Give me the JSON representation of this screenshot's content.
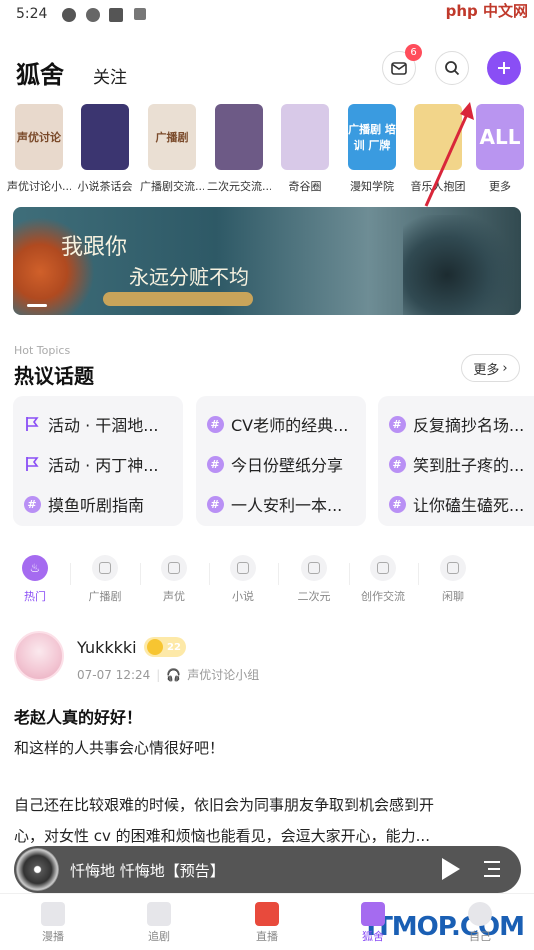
{
  "status": {
    "time": "5:24",
    "watermark": "php 中文网"
  },
  "header": {
    "title": "狐舍",
    "follow": "关注",
    "mail_badge": "6"
  },
  "circles": [
    {
      "label": "声优讨论小...",
      "thumb_text": "声优讨论",
      "color": "#e8d9cc"
    },
    {
      "label": "小说茶话会",
      "thumb_text": "",
      "color": "#3b3570"
    },
    {
      "label": "广播剧交流...",
      "thumb_text": "广播剧",
      "color": "#eadfd3"
    },
    {
      "label": "二次元交流...",
      "thumb_text": "",
      "color": "#6d5a86"
    },
    {
      "label": "奇谷圈",
      "thumb_text": "",
      "color": "#d8c9e8"
    },
    {
      "label": "漫知学院",
      "thumb_text": "广播剧 培训 厂牌",
      "color": "#3a9be0"
    },
    {
      "label": "音乐人抱团",
      "thumb_text": "",
      "color": "#f2d58a"
    },
    {
      "label": "更多",
      "thumb_text": "ALL",
      "color": "#b995f0"
    }
  ],
  "banner": {
    "line1": "我跟你",
    "line2": "永远分赃不均"
  },
  "hot": {
    "en": "Hot Topics",
    "title": "热议话题",
    "more": "更多"
  },
  "topics": [
    [
      {
        "icon": "flag",
        "text": "活动 · 干涸地..."
      },
      {
        "icon": "flag",
        "text": "活动 · 丙丁神..."
      },
      {
        "icon": "hash",
        "text": "摸鱼听剧指南"
      }
    ],
    [
      {
        "icon": "hash",
        "text": "CV老师的经典..."
      },
      {
        "icon": "hash",
        "text": "今日份壁纸分享"
      },
      {
        "icon": "hash",
        "text": "一人安利一本..."
      }
    ],
    [
      {
        "icon": "hash",
        "text": "反复摘抄名场..."
      },
      {
        "icon": "hash",
        "text": "笑到肚子疼的..."
      },
      {
        "icon": "hash",
        "text": "让你磕生磕死..."
      }
    ]
  ],
  "categories": [
    {
      "label": "热门",
      "icon": "fire-icon",
      "active": true
    },
    {
      "label": "广播剧",
      "icon": "radio-icon",
      "active": false
    },
    {
      "label": "声优",
      "icon": "mic-icon",
      "active": false
    },
    {
      "label": "小说",
      "icon": "book-icon",
      "active": false
    },
    {
      "label": "二次元",
      "icon": "disc-icon",
      "active": false
    },
    {
      "label": "创作交流",
      "icon": "bulb-icon",
      "active": false
    },
    {
      "label": "闲聊",
      "icon": "coffee-icon",
      "active": false
    }
  ],
  "post": {
    "username": "Yukkkki",
    "level": "22",
    "time": "07-07 12:24",
    "group": "声优讨论小组",
    "title": "老赵人真的好好！",
    "line1": "和这样的人共事会心情很好吧！",
    "line2": "自己还在比较艰难的时候，依旧会为同事朋友争取到机会感到开",
    "line3": "心，对女性 cv 的困难和烦恼也能看见，会逗大家开心，能力..."
  },
  "player": {
    "title": "忏悔地 忏悔地【预告】"
  },
  "tabs": [
    {
      "label": "漫播",
      "active": false
    },
    {
      "label": "追剧",
      "active": false
    },
    {
      "label": "直播",
      "active": false
    },
    {
      "label": "狐舍",
      "active": true
    },
    {
      "label": "自己",
      "active": false
    }
  ],
  "footer_watermark": "ITMOP.COM"
}
